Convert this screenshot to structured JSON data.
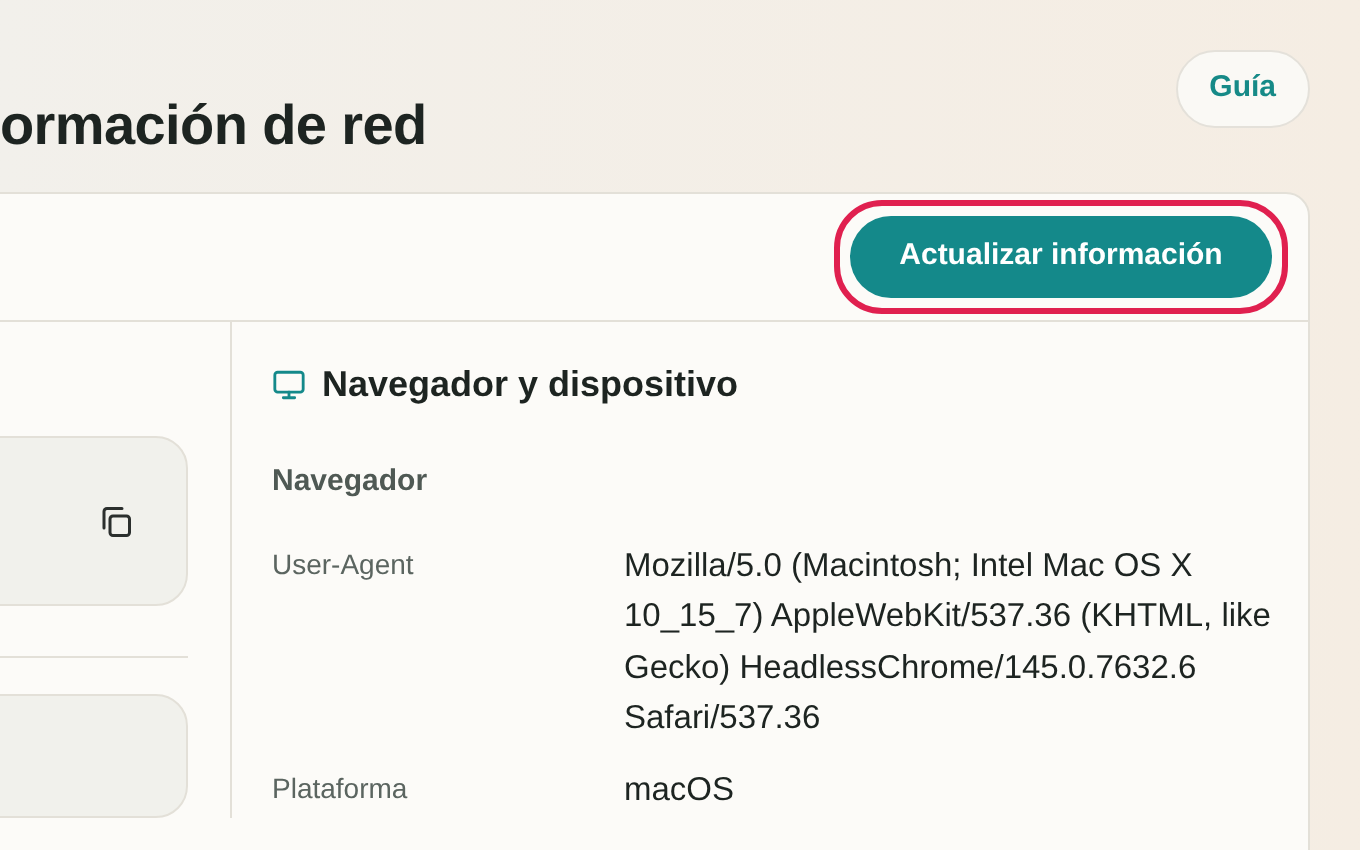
{
  "page": {
    "title": "ormación de red",
    "guide_button": "Guía"
  },
  "toolbar": {
    "refresh_button": {
      "label": "Actualizar información",
      "highlighted": true
    }
  },
  "left_panel": {
    "cards": [
      {
        "kind": "copyable"
      },
      {
        "kind": "plain"
      }
    ]
  },
  "browser_section": {
    "title": "Navegador y dispositivo",
    "group": "Navegador",
    "rows": [
      {
        "label": "User-Agent",
        "value": "Mozilla/5.0 (Macintosh; Intel Mac OS X 10_15_7) AppleWebKit/537.36 (KHTML, like Gecko) HeadlessChrome/145.0.7632.6 Safari/537.36"
      },
      {
        "label": "Plataforma",
        "value": "macOS"
      }
    ]
  }
}
